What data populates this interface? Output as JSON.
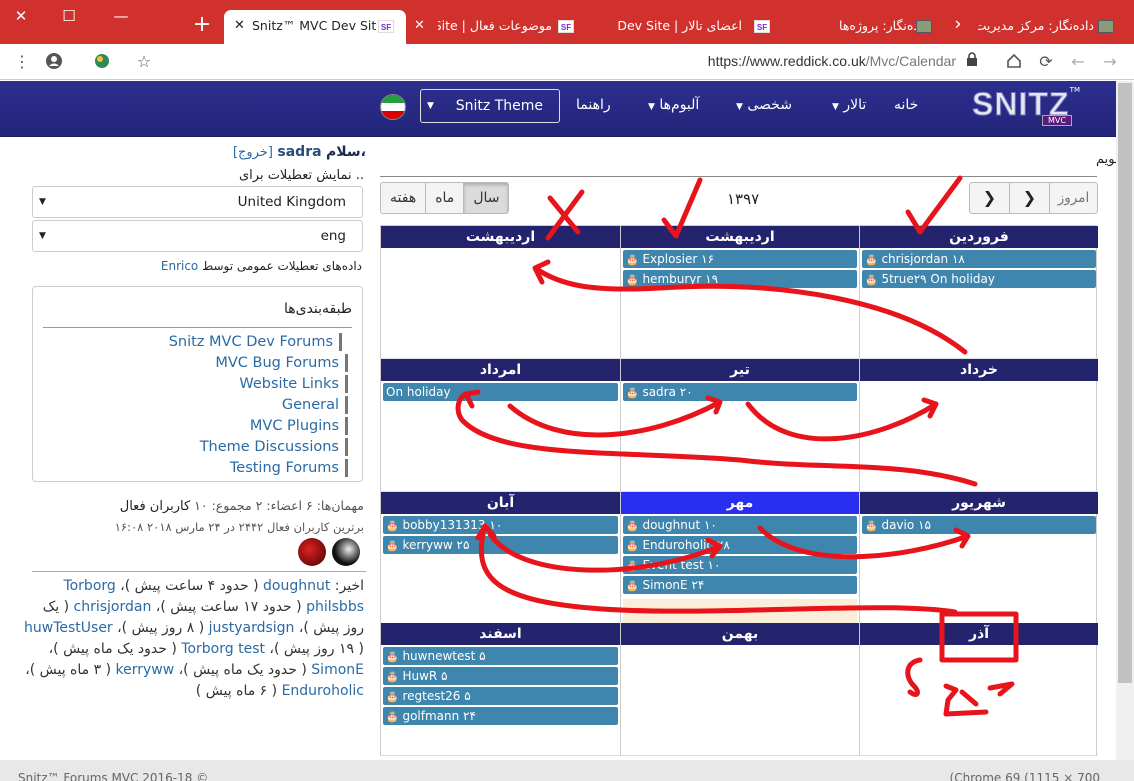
{
  "browser": {
    "tabs": [
      {
        "title": "Snitz™ MVC Dev Site |",
        "active": true
      },
      {
        "title": "موضوعات فعال | Site"
      },
      {
        "title": "اعضای تالار | Dev Site"
      },
      {
        "title": "داده‌نگار: پروژه‌ها"
      },
      {
        "title": "داده‌نگار: مرکز مدیریت"
      }
    ],
    "favicon_sf": "SF",
    "url_host": "https://www.reddick.co.uk",
    "url_path": "/Mvc/Calendar",
    "tab_close": "✕",
    "new_tab": "+",
    "win_close": "✕",
    "win_max": "☐",
    "win_min": "—"
  },
  "nav": {
    "home": "خانه",
    "forum": "تالار",
    "personal": "شخصی",
    "albums": "آلبوم‌ها",
    "help": "راهنما",
    "theme": "Snitz Theme",
    "logo_text": "SNITZ",
    "logo_sub": "MVC",
    "logo_tm": "TM"
  },
  "user": {
    "hello": "سلام،",
    "name": "sadra",
    "logout": "[خروج]"
  },
  "prefs": {
    "show_for": "نمایش تعطیلات برای ..",
    "country": "United Kingdom",
    "lang": "eng",
    "public_note": "داده‌های تعطیلات عمومی توسط",
    "public_by": "Enrico"
  },
  "categories": {
    "title": "طبقه‌بندی‌ها",
    "items": [
      "Snitz MVC Dev Forums",
      "MVC Bug Forums",
      "Website Links",
      "General",
      "MVC Plugins",
      "Theme Discussions",
      "Testing Forums"
    ]
  },
  "online": {
    "heading": "کاربران فعال",
    "stats": "مهمان‌ها: ۶  اعضاء: ۲  مجموع: ۱۰",
    "record": "برترین کاربران فعال ۲۴۴۲ در ۲۴ مارس ۲۰۱۸ ۱۶:۰۸"
  },
  "recent": {
    "label": "اخیر:",
    "entries": [
      {
        "name": "doughnut",
        "when": "( حدود ۴ ساعت پیش )"
      },
      {
        "name": "Torborg",
        "when": ""
      },
      {
        "name": "philsbbs",
        "when": "( حدود ۱۷ ساعت پیش )"
      },
      {
        "name": "chrisjordan",
        "when": "( یک روز پیش )"
      },
      {
        "name": "justyardsign",
        "when": "( ۸ روز پیش )"
      },
      {
        "name": "huwTestUser",
        "when": "( ۱۹ روز پیش )"
      },
      {
        "name": "Torborg test",
        "when": "( حدود یک ماه پیش )"
      },
      {
        "name": "SimonE",
        "when": "( حدود یک ماه پیش )"
      },
      {
        "name": "kerryww",
        "when": "( ۳ ماه پیش )"
      },
      {
        "name": "Enduroholic",
        "when": "( حدود یک ماه پیش )"
      },
      {
        "name": "",
        "when": "( ۶ ماه پیش )"
      }
    ]
  },
  "calendar": {
    "breadcrumb": "تقویم",
    "view_week": "هفته",
    "view_month": "ماه",
    "view_year": "سال",
    "year": "۱۳۹۷",
    "today": "امروز",
    "prev": "‹",
    "next": "›",
    "cake": "🎂",
    "months": [
      {
        "name": "فروردین",
        "events": [
          "chrisjordan ۱۸",
          "5true۲۹ On holiday"
        ]
      },
      {
        "name": "اردیبهشت",
        "events": [
          "Explosier ۱۶",
          "hemburyr ۱۹"
        ]
      },
      {
        "name": "اردیبهشت",
        "events": []
      },
      {
        "name": "خرداد",
        "events": []
      },
      {
        "name": "تیر",
        "events": [
          "sadra ۲۰"
        ]
      },
      {
        "name": "امرداد",
        "events": [
          "On holiday"
        ]
      },
      {
        "name": "شهریور",
        "events": [
          "davio ۱۵"
        ]
      },
      {
        "name": "مهر",
        "events": [
          "doughnut ۱۰",
          "Enduroholic ۲۸",
          "Event test ۱۰",
          "SimonE ۲۴"
        ],
        "current": true
      },
      {
        "name": "آبان",
        "events": [
          "bobby131313 ۱۰",
          "kerryww ۲۵"
        ]
      },
      {
        "name": "آذر",
        "events": []
      },
      {
        "name": "بهمن",
        "events": []
      },
      {
        "name": "اسفند",
        "events": [
          "huwnewtest ۵",
          "HuwR ۵",
          "regtest26 ۵",
          "golfmann ۲۴"
        ]
      }
    ]
  },
  "footer": {
    "left": "Snitz™ Forums MVC 2016-18 ©",
    "right": "(Chrome 69 (1115 × 700"
  },
  "colors": {
    "tabbar": "#d0312d",
    "navbar": "#2c2e8e",
    "month_header": "#23236e",
    "current_month": "#2a2ef0",
    "event": "#3e86ad",
    "annotation": "#e8141b"
  }
}
